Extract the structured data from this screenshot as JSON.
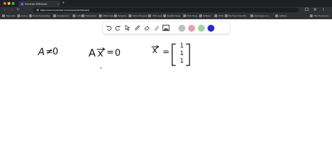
{
  "browser": {
    "tab_title": "Numerade Whiteboard",
    "tab_close": "×",
    "new_tab": "+",
    "back": "←",
    "forward": "→",
    "reload": "↻",
    "url": "https://www.numerade.com/answer/whiteboard/",
    "bookmarks": [
      "Sites Used",
      "Coding",
      "Books Downloading",
      "Entertainment",
      "LaTeX",
      "Mathematics",
      "CBSE Notes",
      "Bangalore",
      "Online Shopping",
      "HTML Ideas",
      "StackExchange",
      "PNG Things",
      "Software",
      "UPSC",
      "Buy New & Used Bo...",
      "acaeimages in a...",
      "HelBeine",
      "Other Bookmarks"
    ]
  },
  "toolbar": {
    "tools": [
      "undo-icon",
      "redo-icon",
      "select-icon",
      "pen-icon",
      "eraser-icon",
      "highlighter-icon",
      "image-icon"
    ],
    "colors": [
      "#bdbdbd",
      "#e9a0a6",
      "#99d79d",
      "#1e2bd6"
    ]
  },
  "whiteboard": {
    "expr1_lhs": "A",
    "expr1_rel": "≠",
    "expr1_rhs": "0",
    "expr2_a": "A",
    "expr2_x": "x",
    "expr2_eq": "=",
    "expr2_rhs": "0",
    "expr3_x": "x",
    "expr3_eq": "=",
    "vector_entries": [
      "1",
      "1",
      "1"
    ]
  }
}
